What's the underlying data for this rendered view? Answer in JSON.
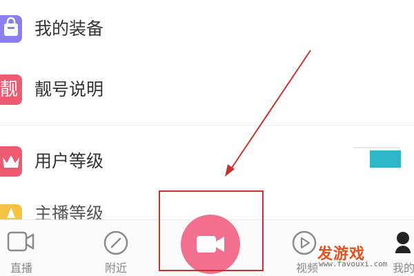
{
  "menu": {
    "items": [
      {
        "label": "我的装备",
        "icon": "bag-icon",
        "color": "#8c7df0"
      },
      {
        "label": "靓号说明",
        "icon": "liang-badge-icon",
        "icon_text": "靓",
        "color": "#ee5a6f"
      },
      {
        "label": "用户等级",
        "icon": "crown-icon",
        "color": "#ee5a6f"
      },
      {
        "label": "主播等级",
        "icon": "star-icon",
        "color": "#f6c244"
      }
    ]
  },
  "tabbar": {
    "tabs": [
      {
        "label": "直播",
        "icon": "live-camera-icon"
      },
      {
        "label": "附近",
        "icon": "compass-icon"
      },
      {
        "label": "",
        "icon": "video-record-icon",
        "accent": "#f26f8e"
      },
      {
        "label": "视频",
        "icon": "play-icon"
      },
      {
        "label": "我的",
        "icon": "profile-icon"
      }
    ]
  },
  "annotation": {
    "color": "#c9302c"
  },
  "watermark": {
    "title": "发游戏",
    "url": "www.favouxi.com"
  }
}
